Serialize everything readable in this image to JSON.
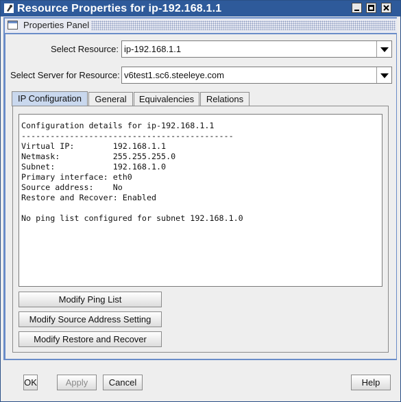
{
  "window": {
    "title": "Resource Properties for ip-192.168.1.1"
  },
  "panel": {
    "title": "Properties Panel"
  },
  "form": {
    "resource_label": "Select Resource:",
    "resource_value": "ip-192.168.1.1",
    "server_label": "Select Server for Resource:",
    "server_value": "v6test1.sc6.steeleye.com"
  },
  "tabs": [
    {
      "label": "IP Configuration",
      "active": true
    },
    {
      "label": "General",
      "active": false
    },
    {
      "label": "Equivalencies",
      "active": false
    },
    {
      "label": "Relations",
      "active": false
    }
  ],
  "config": {
    "lines": [
      "Configuration details for ip-192.168.1.1",
      "--------------------------------------------",
      "Virtual IP:        192.168.1.1",
      "Netmask:           255.255.255.0",
      "Subnet:            192.168.1.0",
      "Primary interface: eth0",
      "Source address:    No",
      "Restore and Recover: Enabled",
      "",
      "No ping list configured for subnet 192.168.1.0"
    ]
  },
  "actions": {
    "modify_ping": "Modify Ping List",
    "modify_source": "Modify Source Address Setting",
    "modify_restore": "Modify Restore and Recover"
  },
  "footer": {
    "ok": "OK",
    "apply": "Apply",
    "cancel": "Cancel",
    "help": "Help"
  },
  "colors": {
    "titlebar": "#2e5a9a",
    "frame": "#6a8dc8",
    "active_tab": "#c9d8ee"
  }
}
